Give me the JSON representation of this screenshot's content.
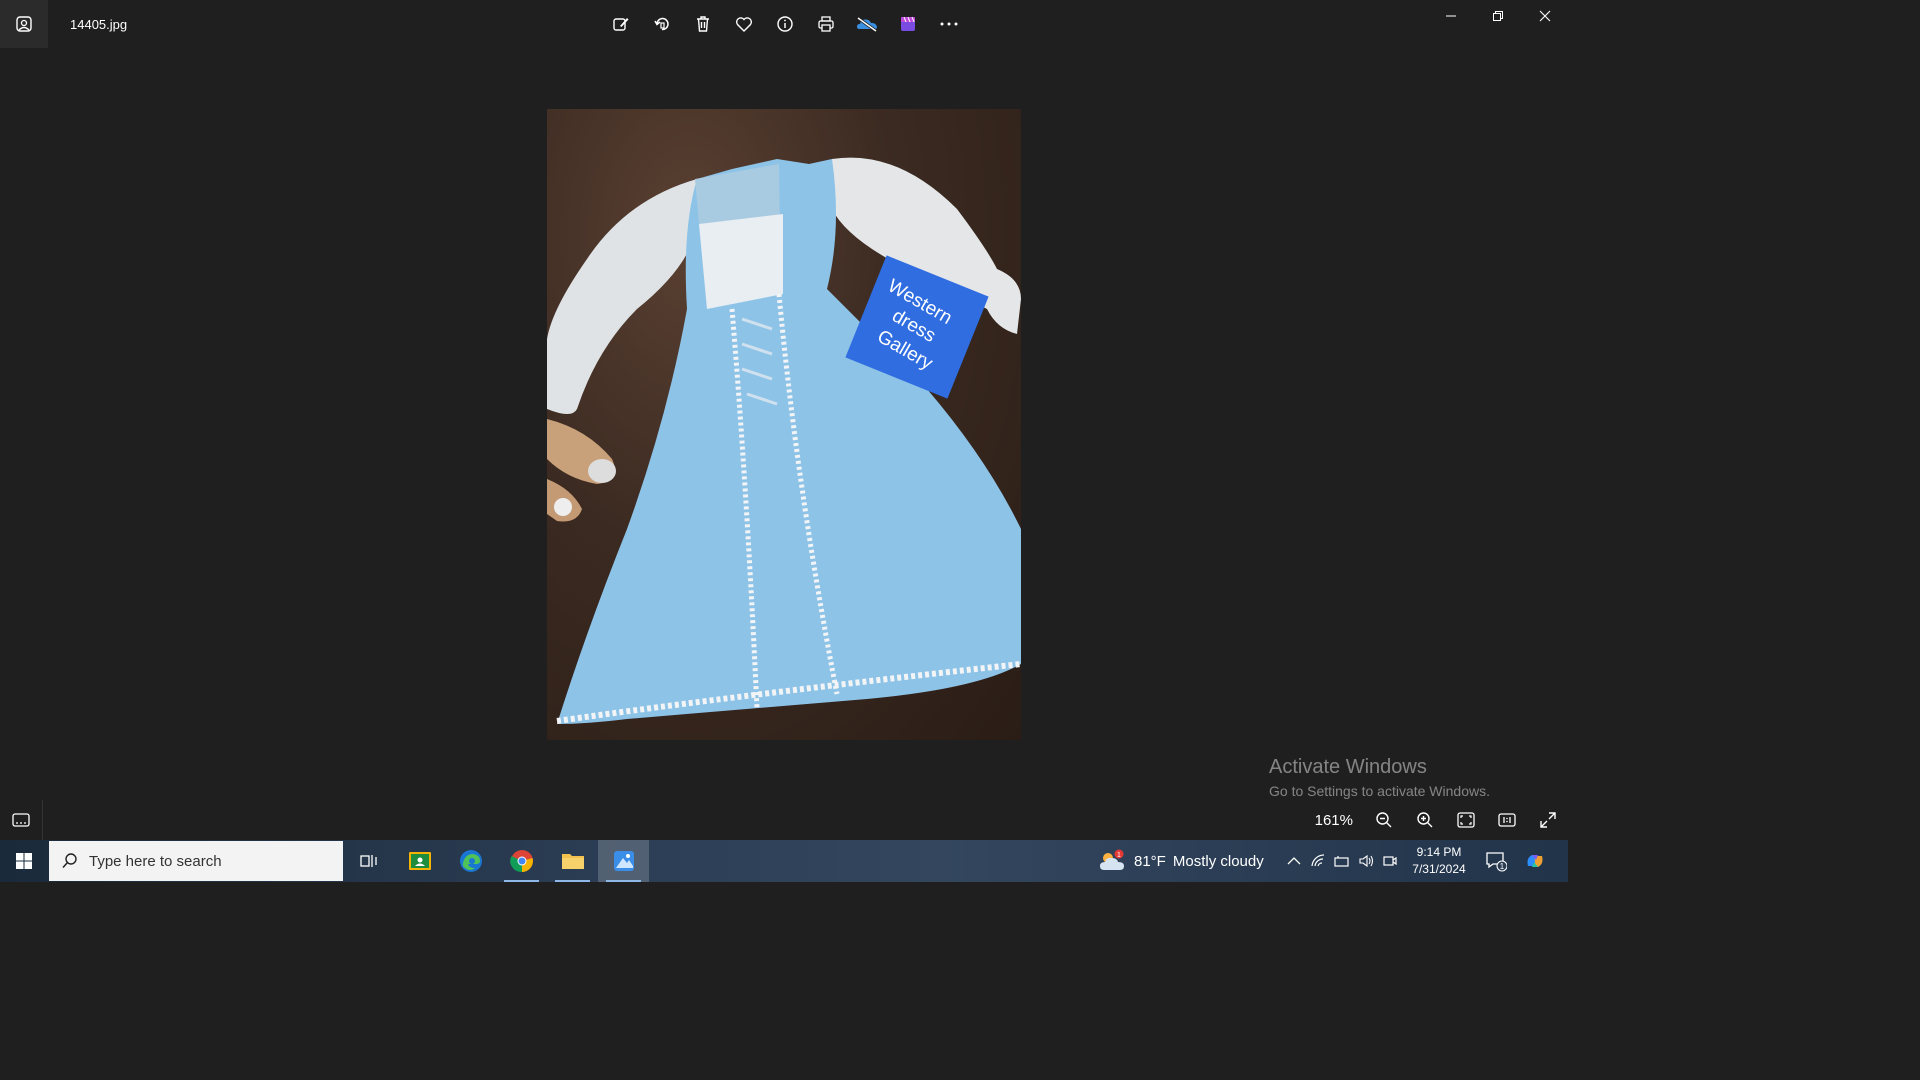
{
  "titlebar": {
    "filename": "14405.jpg"
  },
  "toolbar": {
    "buttons": [
      "edit-image-icon",
      "rotate-icon",
      "delete-icon",
      "favorite-icon",
      "info-icon",
      "print-icon",
      "onedrive-icon",
      "clipchamp-icon",
      "more-icon"
    ]
  },
  "photo": {
    "sign_line1": "Western",
    "sign_line2": "dress",
    "sign_line3": "Gallery"
  },
  "watermark": {
    "title": "Activate Windows",
    "subtitle": "Go to Settings to activate Windows."
  },
  "bottombar": {
    "zoom": "161%"
  },
  "taskbar": {
    "search_placeholder": "Type here to search",
    "weather_temp": "81°F",
    "weather_desc": "Mostly cloudy",
    "weather_badge": "1",
    "time": "9:14 PM",
    "date": "7/31/2024",
    "notif_count": "1"
  },
  "colors": {
    "bg": "#1f1f1f",
    "dress": "#8ec3e8",
    "sign": "#2f6de0"
  }
}
